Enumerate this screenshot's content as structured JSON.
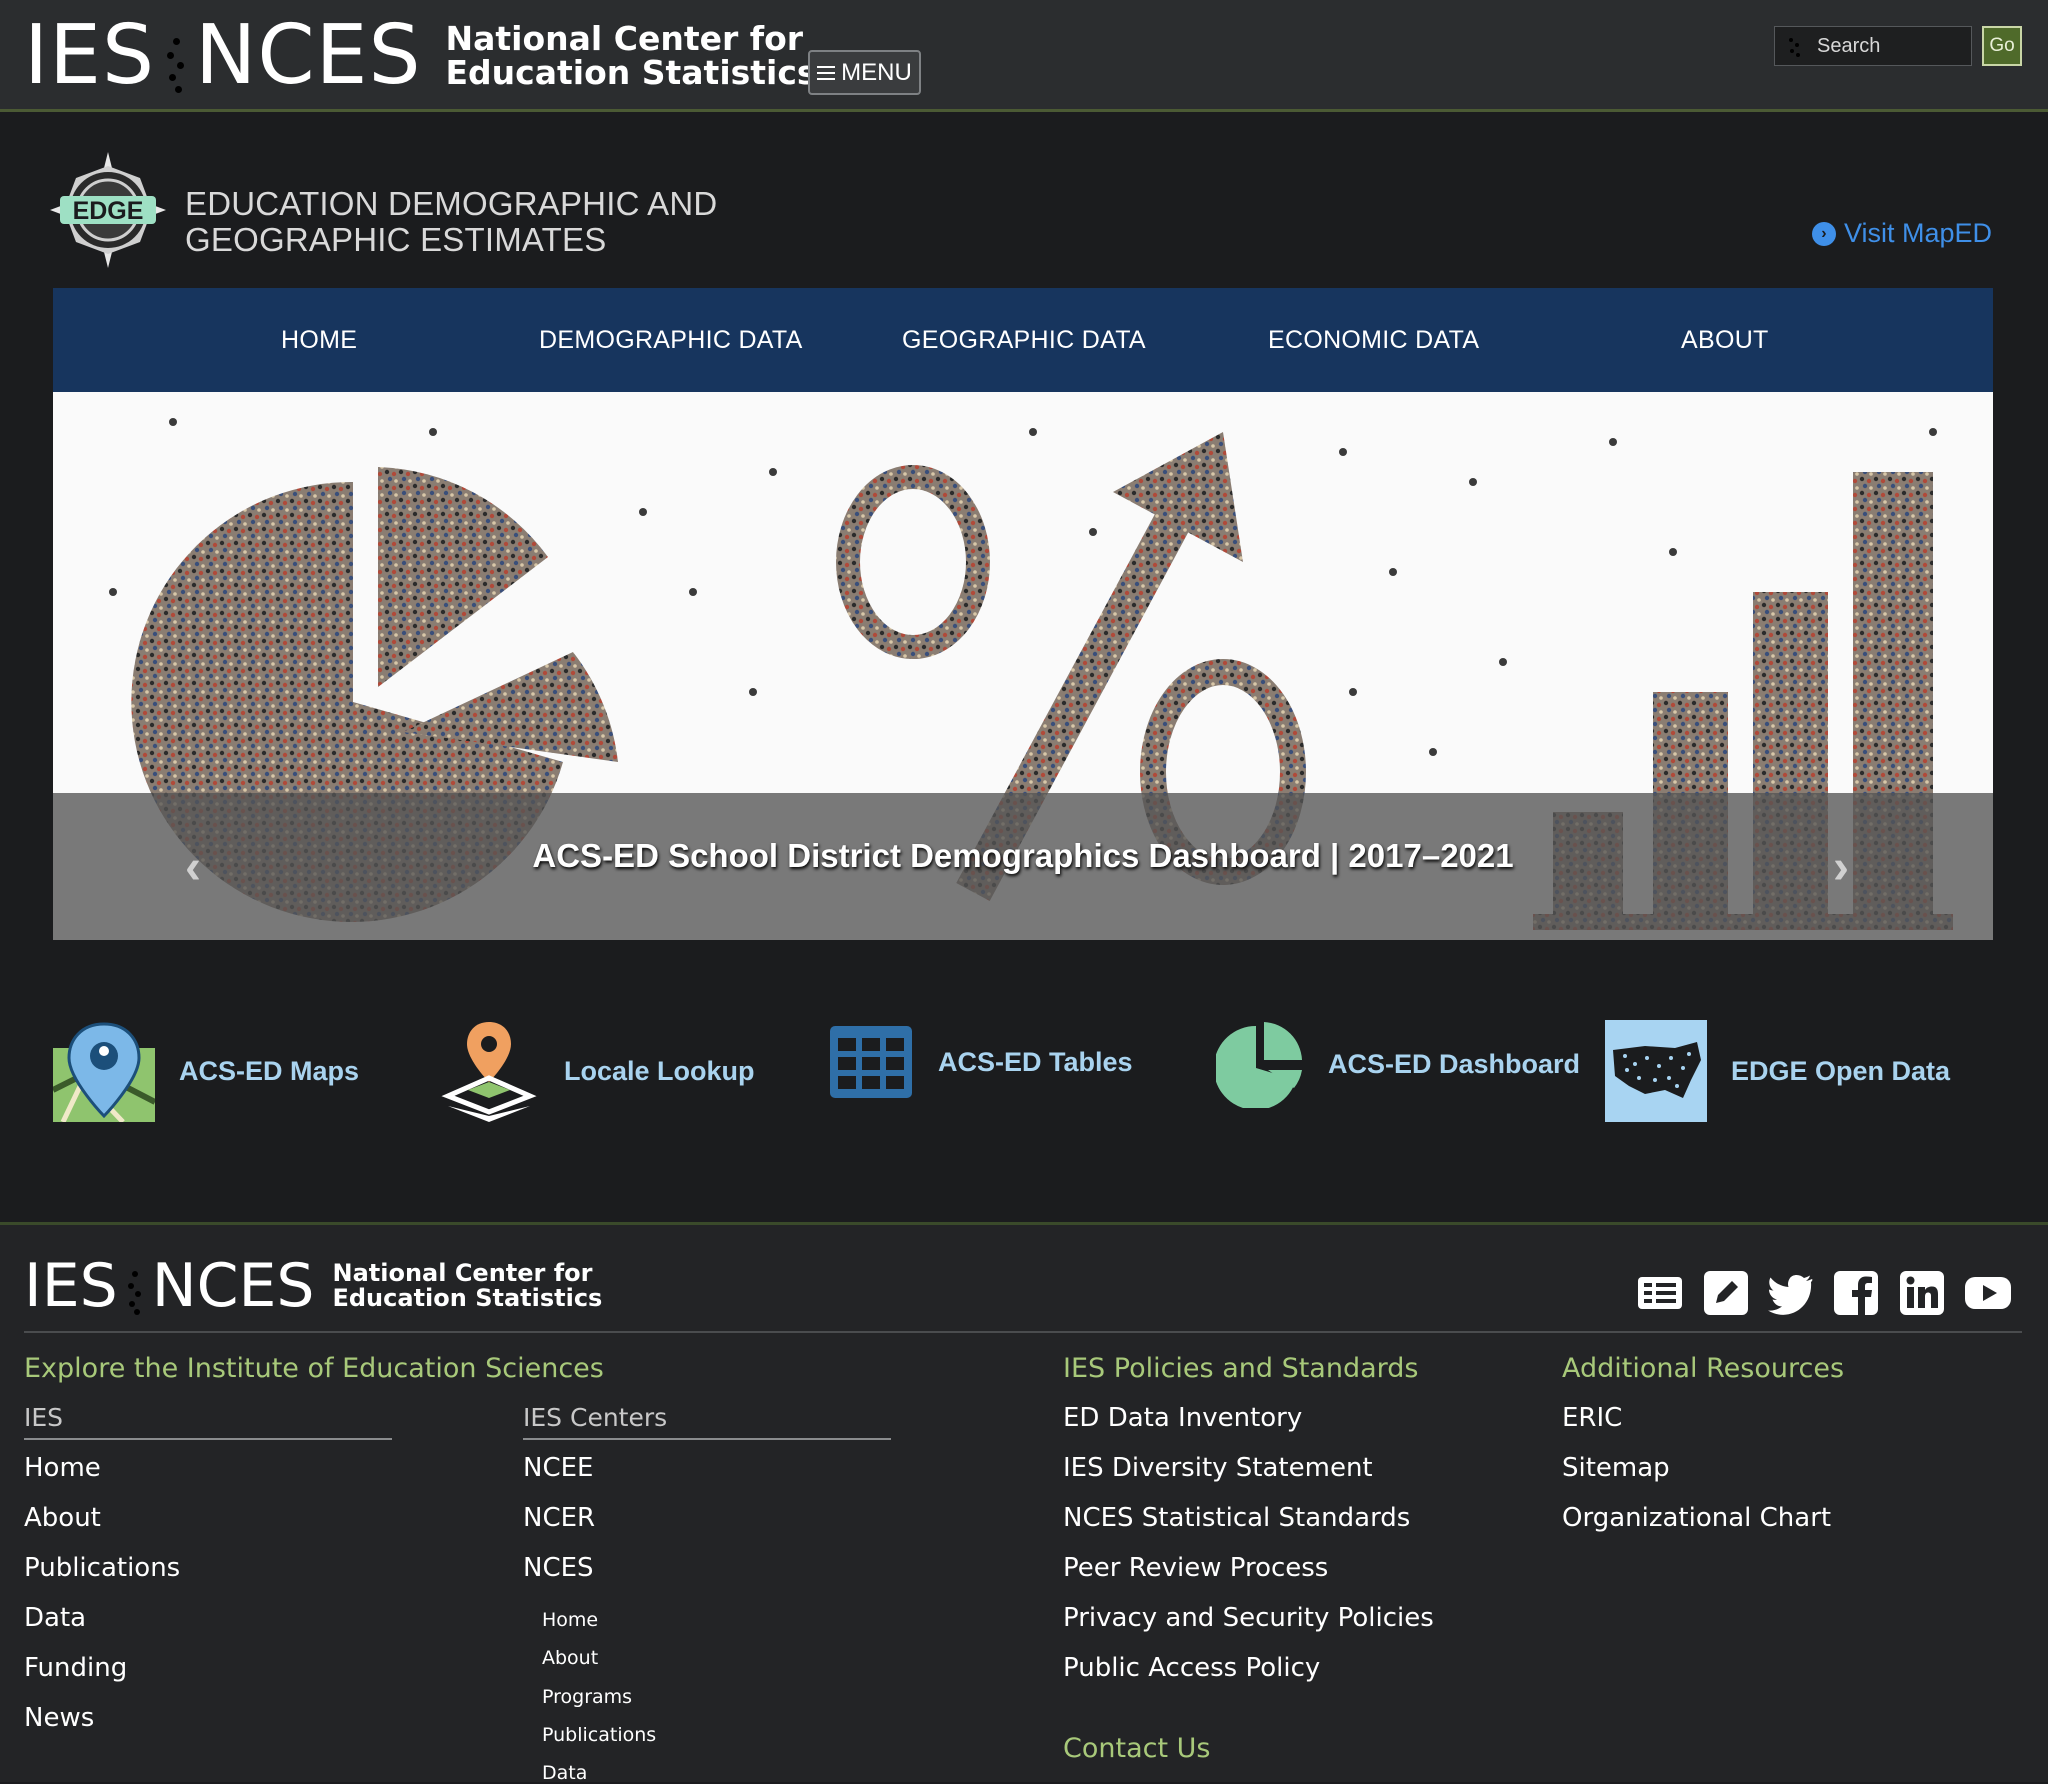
{
  "header": {
    "ies": "IES",
    "nces": "NCES",
    "org_line1": "National Center for",
    "org_line2": "Education Statistics",
    "menu_label": "MENU",
    "search_placeholder": "Search",
    "go_label": "Go"
  },
  "edge": {
    "logo_text": "EDGE",
    "title_line1": "Education Demographic and",
    "title_line2": "Geographic Estimates",
    "visit_label": "Visit MapED"
  },
  "nav": {
    "items": [
      {
        "label": "HOME"
      },
      {
        "label": "DEMOGRAPHIC DATA"
      },
      {
        "label": "GEOGRAPHIC DATA"
      },
      {
        "label": "ECONOMIC DATA"
      },
      {
        "label": "ABOUT"
      }
    ]
  },
  "hero": {
    "caption": "ACS-ED School District Demographics Dashboard | 2017–2021",
    "prev_icon": "chevron-left-icon",
    "next_icon": "chevron-right-icon"
  },
  "tools": [
    {
      "label": "ACS-ED Maps",
      "icon": "map-pin-icon"
    },
    {
      "label": "Locale Lookup",
      "icon": "location-layers-icon"
    },
    {
      "label": "ACS-ED Tables",
      "icon": "table-grid-icon"
    },
    {
      "label": "ACS-ED Dashboard",
      "icon": "pie-chart-icon"
    },
    {
      "label": "EDGE Open Data",
      "icon": "us-map-icon"
    }
  ],
  "footer": {
    "ies": "IES",
    "nces": "NCES",
    "org_line1": "National Center for",
    "org_line2": "Education Statistics",
    "social_icons": [
      "newsletter-icon",
      "blog-icon",
      "twitter-icon",
      "facebook-icon",
      "linkedin-icon",
      "youtube-icon"
    ],
    "explore_heading": "Explore the Institute of Education Sciences",
    "ies_col": {
      "heading": "IES",
      "links": [
        "Home",
        "About",
        "Publications",
        "Data",
        "Funding",
        "News"
      ]
    },
    "centers_col": {
      "heading": "IES Centers",
      "links": [
        "NCEE",
        "NCER",
        "NCES"
      ],
      "nces_sublinks": [
        "Home",
        "About",
        "Programs",
        "Publications",
        "Data"
      ]
    },
    "policies_col": {
      "heading": "IES Policies and Standards",
      "links": [
        "ED Data Inventory",
        "IES Diversity Statement",
        "NCES Statistical Standards",
        "Peer Review Process",
        "Privacy and Security Policies",
        "Public Access Policy"
      ],
      "contact": "Contact Us"
    },
    "resources_col": {
      "heading": "Additional Resources",
      "links": [
        "ERIC",
        "Sitemap",
        "Organizational Chart"
      ]
    }
  },
  "colors": {
    "nav_bg": "#17355e",
    "link_blue": "#3f8fe8",
    "tool_label": "#a9d3ef",
    "footer_heading": "#a8c97a",
    "go_button": "#4f6a2a"
  }
}
